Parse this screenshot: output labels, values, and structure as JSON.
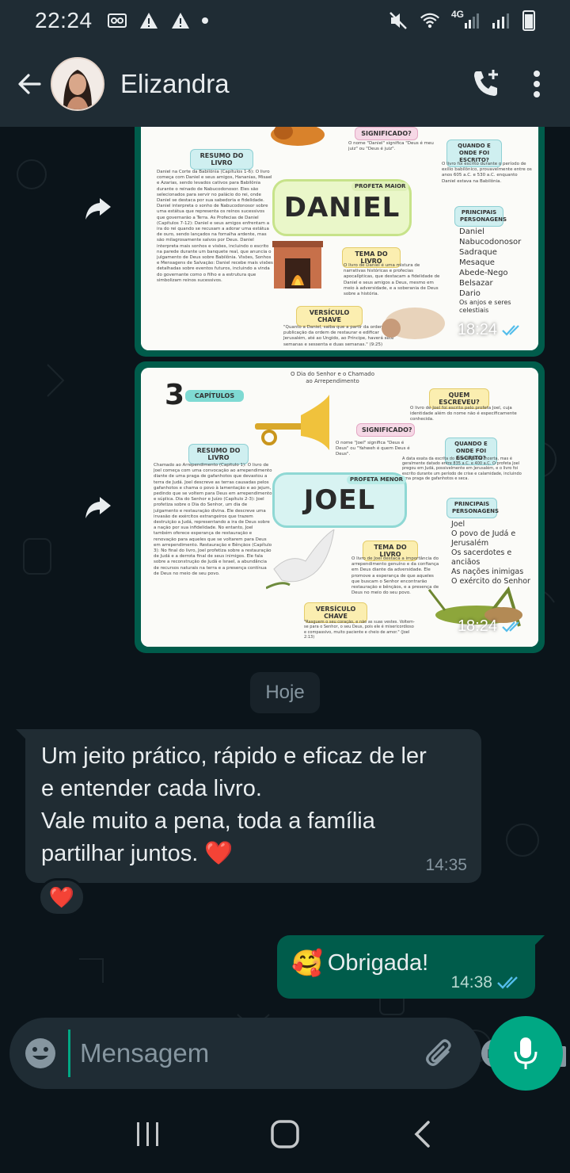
{
  "status_bar": {
    "time": "22:24",
    "network": "4G"
  },
  "header": {
    "contact_name": "Elizandra",
    "icons": [
      "arrow-back-icon",
      "add-call-icon",
      "more-vert-icon"
    ]
  },
  "messages": {
    "image1": {
      "time": "18:24",
      "infographic": {
        "name": "DANIEL",
        "label_profeta": "PROFETA MAIOR",
        "label_resumo": "RESUMO DO LIVRO",
        "label_significado": "SIGNIFICADO?",
        "label_quando": "QUANDO E ONDE FOI ESCRITO?",
        "label_personagens": "PRINCIPAIS PERSONAGENS",
        "label_tema": "TEMA DO LIVRO",
        "label_versiculo": "VERSÍCULO CHAVE",
        "significado_text": "O nome \"Daniel\" significa \"Deus é meu juiz\" ou \"Deus é juiz\".",
        "quando_text": "O livro foi escrito durante o período de exílio babilônico, provavelmente entre os anos 605 a.C. e 530 a.C. enquanto Daniel estava na Babilônia.",
        "personagens": [
          "Daniel",
          "Nabucodonosor",
          "Sadraque",
          "Mesaque",
          "Abede-Nego",
          "Belsazar",
          "Dario",
          "Os anjos e seres celestiais"
        ],
        "resumo_text": "Daniel na Corte da Babilônia (Capítulos 1-6): O livro começa com Daniel e seus amigos, Hananias, Misael e Azarias, sendo levados cativos para Babilônia durante o reinado de Nabucodonosor. Eles são selecionados para servir no palácio do rei, onde Daniel se destaca por sua sabedoria e fidelidade. Daniel interpreta o sonho de Nabucodonosor sobre uma estátua que representa os reinos sucessivos que governarão a Terra. As Profecias de Daniel (Capítulos 7-12): Daniel e seus amigos enfrentam a ira do rei quando se recusam a adorar uma estátua de ouro, sendo lançados na fornalha ardente, mas são milagrosamente salvos por Deus. Daniel interpreta mais sonhos e visões, incluindo o escrito na parede durante um banquete real, que anuncia o julgamento de Deus sobre Babilônia. Visões, Sonhos e Mensagens de Salvação: Daniel recebe mais visões detalhadas sobre eventos futuros, incluindo a vinda do governante como o filho e a estrutura que simbolizam reinos sucessivos.",
        "tema_text": "O livro de Daniel é uma mistura de narrativas históricas e profecias apocalípticas, que destacam a fidelidade de Daniel e seus amigos a Deus, mesmo em meio à adversidade, e a soberania de Deus sobre a história.",
        "versiculo_text": "\"Quanto a Daniel, saiba que a partir da ordem de publicação da ordem de restaurar e edificar Jerusalém, até ao Ungido, ao Príncipe, haverá sete semanas e sessenta e duas semanas.\" (9:25)"
      }
    },
    "image2": {
      "time": "18:24",
      "infographic": {
        "chapters_number": "3",
        "chapters_label": "CAPÍTULOS",
        "top_caption": "O Dia do Senhor e o Chamado ao Arrependimento",
        "name": "JOEL",
        "label_profeta": "PROFETA MENOR",
        "label_resumo": "RESUMO DO LIVRO",
        "label_significado": "SIGNIFICADO?",
        "label_quem": "QUEM ESCREVEU?",
        "label_quando": "QUANDO E ONDE FOI ESCRITO?",
        "label_personagens": "PRINCIPAIS PERSONAGENS",
        "label_tema": "TEMA DO LIVRO",
        "label_versiculo": "VERSÍCULO CHAVE",
        "quem_text": "O livro de Joel foi escrito pelo profeta Joel, cuja identidade além do nome não é especificamente conhecida.",
        "significado_text": "O nome \"Joel\" significa \"Deus é Deus\" ou \"Yahweh é quem Deus é Deus\".",
        "quando_text": "A data exata da escrita do livro de Joel é incerta, mas é geralmente datado entre 835 a.C. e 400 a.C. O profeta Joel pregou em Judá, possivelmente em Jerusalém, e o livro foi escrito durante um período de crise e calamidade, incluindo uma praga de gafanhotos e seca.",
        "personagens": [
          "Joel",
          "O povo de Judá e Jerusalém",
          "Os sacerdotes e anciãos",
          "As nações inimigas",
          "O exército do Senhor"
        ],
        "resumo_text": "Chamado ao Arrependimento (Capítulo 1): O livro de Joel começa com uma convocação ao arrependimento diante de uma praga de gafanhotos que devastou a terra de Judá. Joel descreve as terras causadas pelos gafanhotos e chama o povo à lamentação e ao jejum, pedindo que se voltem para Deus em arrependimento e súplica. Dia do Senhor e Juízo (Capítulo 2-3): Joel profetiza sobre o Dia do Senhor, um dia de julgamento e restauração divina. Ele descreve uma invasão de exércitos estrangeiros que trazem destruição a Judá, representando a ira de Deus sobre a nação por sua infidelidade. No entanto, Joel também oferece esperança de restauração e renovação para aqueles que se voltarem para Deus em arrependimento. Restauração e Bênçãos (Capítulo 3): No final do livro, Joel profetiza sobre a restauração de Judá e a derrota final de seus inimigos. Ele fala sobre a reconstrução de Judá e Israel, a abundância de recursos naturais na terra e a presença contínua de Deus no meio de seu povo.",
        "tema_text": "O livro de Joel destaca a importância do arrependimento genuíno e da confiança em Deus diante da adversidade. Ele promove a esperança de que aqueles que buscam o Senhor encontrarão restauração e bênçãos, e a presença de Deus no meio do seu povo.",
        "versiculo_text": "\"Rasguem o seu coração, e não as suas vestes. Voltem-se para o Senhor, o seu Deus, pois ele é misericordioso e compassivo, muito paciente e cheio de amor.\" (Joel 2:13)"
      }
    },
    "date_chip": "Hoje",
    "incoming": {
      "text": "Um jeito prático, rápido e eficaz de ler\ne entender cada livro.\nVale muito a pena, toda a família\npartilhar juntos. ❤️",
      "time": "14:35",
      "reaction": "❤️"
    },
    "outgoing": {
      "emoji": "🥰",
      "text": "Obrigada!",
      "time": "14:38"
    }
  },
  "composer": {
    "placeholder": "Mensagem"
  },
  "colors": {
    "header_bg": "#1f2c34",
    "chat_bg": "#0b141a",
    "outgoing_bubble": "#005c4b",
    "incoming_bubble": "#202c33",
    "accent": "#00a884",
    "read_tick": "#53bdeb"
  }
}
